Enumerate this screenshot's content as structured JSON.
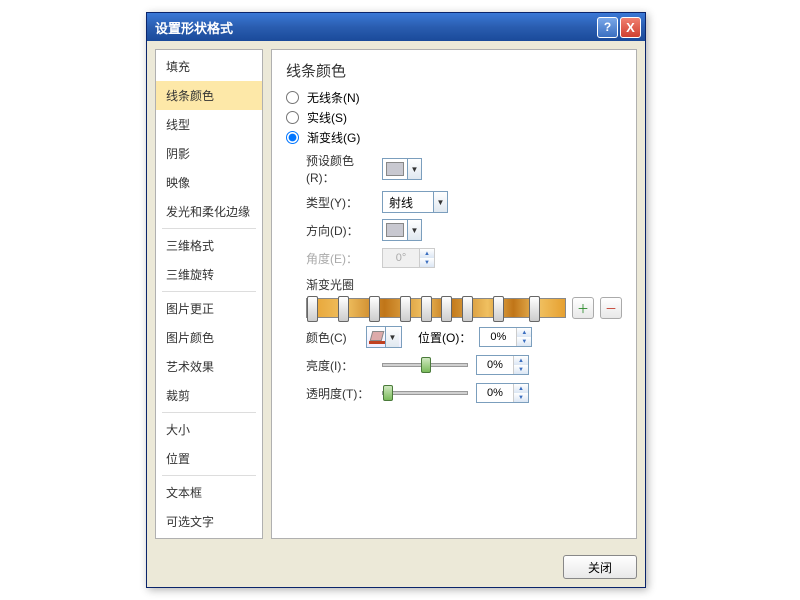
{
  "dialog": {
    "title": "设置形状格式",
    "help_label": "?",
    "close_x": "X"
  },
  "sidebar": {
    "items": [
      {
        "label": "填充"
      },
      {
        "label": "线条颜色",
        "selected": true
      },
      {
        "label": "线型"
      },
      {
        "label": "阴影"
      },
      {
        "label": "映像"
      },
      {
        "label": "发光和柔化边缘"
      },
      {
        "sep": true
      },
      {
        "label": "三维格式"
      },
      {
        "label": "三维旋转"
      },
      {
        "sep": true
      },
      {
        "label": "图片更正"
      },
      {
        "label": "图片颜色"
      },
      {
        "label": "艺术效果"
      },
      {
        "label": "裁剪"
      },
      {
        "sep": true
      },
      {
        "label": "大小"
      },
      {
        "label": "位置"
      },
      {
        "sep": true
      },
      {
        "label": "文本框"
      },
      {
        "label": "可选文字"
      }
    ]
  },
  "panel": {
    "title": "线条颜色",
    "radio_none": "无线条(N)",
    "radio_solid": "实线(S)",
    "radio_gradient": "渐变线(G)",
    "preset_label": "预设颜色(R)：",
    "type_label": "类型(Y)：",
    "type_value": "射线",
    "direction_label": "方向(D)：",
    "angle_label": "角度(E)：",
    "angle_value": "0°",
    "stops_label": "渐变光圈",
    "add_stop": "＋",
    "remove_stop": "－",
    "color_label": "颜色(C)",
    "position_label": "位置(O)：",
    "position_value": "0%",
    "brightness_label": "亮度(I)：",
    "brightness_value": "0%",
    "transparency_label": "透明度(T)：",
    "transparency_value": "0%",
    "stop_positions": [
      2,
      14,
      26,
      38,
      46,
      54,
      62,
      74,
      88
    ]
  },
  "footer": {
    "close": "关闭"
  }
}
